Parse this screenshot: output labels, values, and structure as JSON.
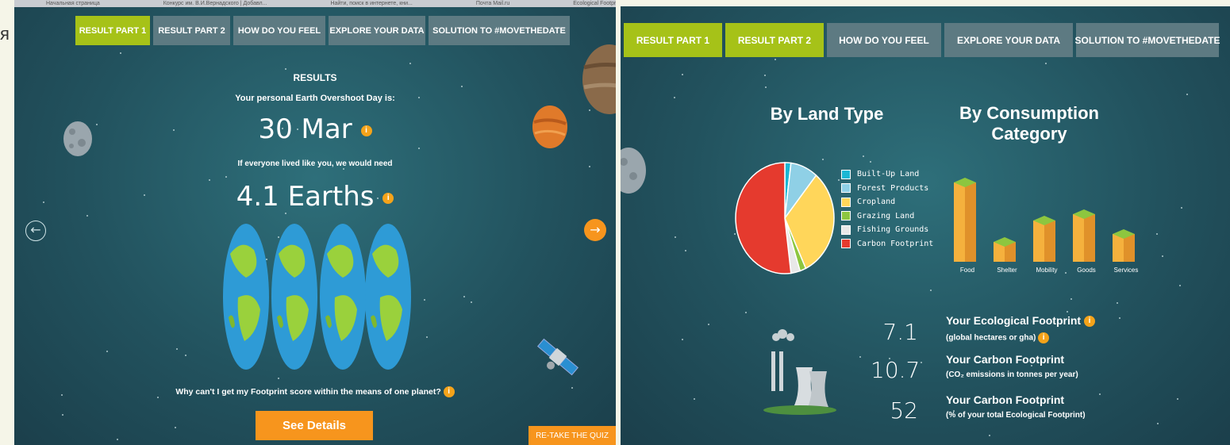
{
  "edge_letter": "я",
  "left_panel": {
    "browser_tabs": [
      "Начальная страница",
      "Конкурс им. В.И.Вернадского | Добавл...",
      "Найти, поиск в интернете, кни...",
      "Почта Mail.ru",
      "Ecological Footprint Calculator"
    ],
    "tabs": [
      {
        "label": "RESULT PART 1",
        "active": true
      },
      {
        "label": "RESULT PART 2",
        "active": false
      },
      {
        "label": "HOW DO YOU FEEL",
        "active": false
      },
      {
        "label": "EXPLORE YOUR DATA",
        "active": false
      },
      {
        "label": "SOLUTION TO #MOVETHEDATE",
        "active": false
      }
    ],
    "results_heading": "RESULTS",
    "personal_label": "Your personal Earth Overshoot Day is:",
    "overshoot_date": "30 Mar",
    "if_everyone_label": "If everyone lived like you, we would need",
    "earths_value": "4.1 Earths",
    "earths_shown": 4,
    "why_question": "Why can't I get my Footprint score within the means of one planet?",
    "see_details_label": "See Details",
    "retake_label": "RE-TAKE THE QUIZ",
    "prev_arrow": "←",
    "next_arrow": "→",
    "info_glyph": "i"
  },
  "right_panel": {
    "tabs": [
      {
        "label": "RESULT PART 1",
        "active": true
      },
      {
        "label": "RESULT PART 2",
        "active": true
      },
      {
        "label": "HOW DO YOU FEEL",
        "active": false
      },
      {
        "label": "EXPLORE YOUR DATA",
        "active": false
      },
      {
        "label": "SOLUTION TO #MOVETHEDATE",
        "active": false
      }
    ],
    "land_type_title": "By Land Type",
    "consumption_title_line1": "By Consumption",
    "consumption_title_line2": "Category",
    "legend": [
      {
        "label": "Built-Up Land",
        "color": "#1ab7d4"
      },
      {
        "label": "Forest Products",
        "color": "#8fd0e6"
      },
      {
        "label": "Cropland",
        "color": "#ffd65a"
      },
      {
        "label": "Grazing Land",
        "color": "#8dc63f"
      },
      {
        "label": "Fishing Grounds",
        "color": "#e8e8e8"
      },
      {
        "label": "Carbon Footprint",
        "color": "#e53a2e"
      }
    ],
    "categories": [
      "Food",
      "Shelter",
      "Mobility",
      "Goods",
      "Services"
    ],
    "stats": [
      {
        "value": "7.1",
        "title": "Your Ecological Footprint",
        "subtitle": "(global hectares or gha)"
      },
      {
        "value": "10.7",
        "title": "Your Carbon Footprint",
        "subtitle": "(CO₂ emissions in tonnes per year)"
      },
      {
        "value": "52",
        "title": "Your Carbon Footprint",
        "subtitle": "(% of your total Ecological Footprint)"
      }
    ]
  },
  "chart_data": [
    {
      "type": "pie",
      "title": "By Land Type",
      "categories": [
        "Built-Up Land",
        "Forest Products",
        "Cropland",
        "Grazing Land",
        "Fishing Grounds",
        "Carbon Footprint"
      ],
      "values": [
        2,
        9,
        32,
        2,
        3,
        52
      ],
      "colors": [
        "#1ab7d4",
        "#8fd0e6",
        "#ffd65a",
        "#8dc63f",
        "#e8e8e8",
        "#e53a2e"
      ],
      "legend": "right"
    },
    {
      "type": "bar",
      "title": "By Consumption Category",
      "categories": [
        "Food",
        "Shelter",
        "Mobility",
        "Goods",
        "Services"
      ],
      "values": [
        100,
        25,
        52,
        60,
        35
      ],
      "color": "#f5a31a"
    }
  ]
}
